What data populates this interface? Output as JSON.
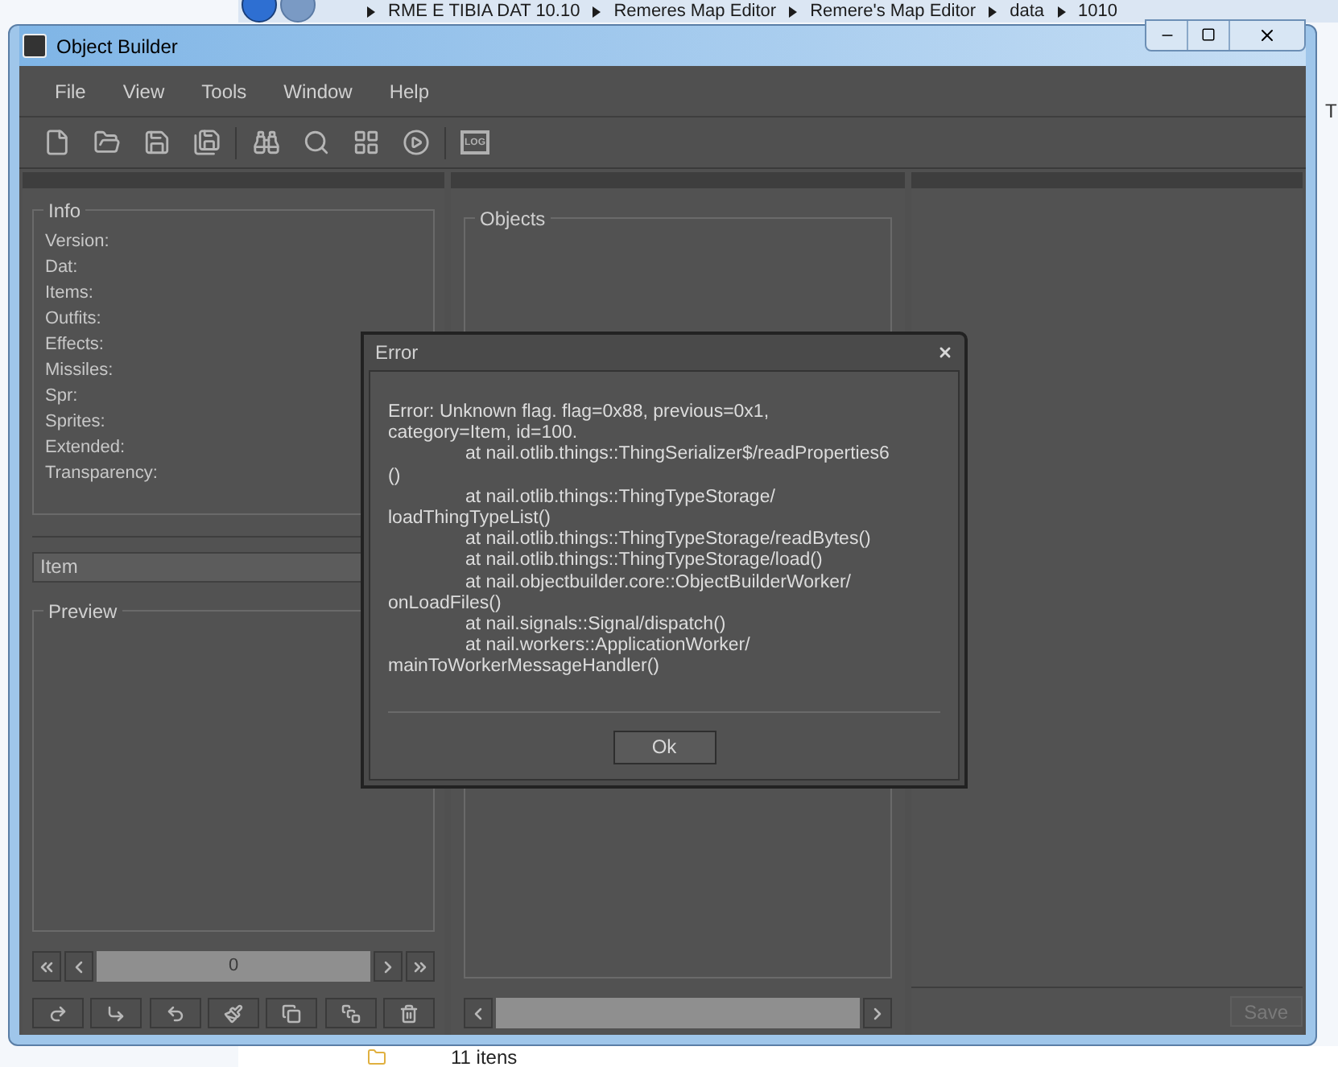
{
  "explorer": {
    "path": [
      "RME E TIBIA DAT 10.10",
      "Remeres Map Editor",
      "Remere's Map Editor",
      "data",
      "1010"
    ],
    "status": "11 itens",
    "edge_text": "T"
  },
  "window": {
    "title": "Object Builder"
  },
  "menu": [
    "File",
    "View",
    "Tools",
    "Window",
    "Help"
  ],
  "toolbar": {
    "log_label": "LOG"
  },
  "info": {
    "title": "Info",
    "fields": [
      "Version:",
      "Dat:",
      "Items:",
      "Outfits:",
      "Effects:",
      "Missiles:",
      "Spr:",
      "Sprites:",
      "Extended:",
      "Transparency:"
    ]
  },
  "category": {
    "value": "Item"
  },
  "preview": {
    "title": "Preview",
    "frame": "0"
  },
  "objects": {
    "title": "Objects"
  },
  "save_button": {
    "label": "Save",
    "disabled": true
  },
  "dialog": {
    "title": "Error",
    "button": "Ok",
    "lines": [
      {
        "text": "Error: Unknown flag. flag=0x88, previous=0x1,",
        "indented": false
      },
      {
        "text": "category=Item, id=100.",
        "indented": false
      },
      {
        "text": "at nail.otlib.things::ThingSerializer$/readProperties6",
        "indented": true
      },
      {
        "text": "()",
        "indented": false
      },
      {
        "text": "at nail.otlib.things::ThingTypeStorage/",
        "indented": true
      },
      {
        "text": "loadThingTypeList()",
        "indented": false
      },
      {
        "text": "at nail.otlib.things::ThingTypeStorage/readBytes()",
        "indented": true
      },
      {
        "text": "at nail.otlib.things::ThingTypeStorage/load()",
        "indented": true
      },
      {
        "text": "at nail.objectbuilder.core::ObjectBuilderWorker/",
        "indented": true
      },
      {
        "text": "onLoadFiles()",
        "indented": false
      },
      {
        "text": "at nail.signals::Signal/dispatch()",
        "indented": true
      },
      {
        "text": "at nail.workers::ApplicationWorker/",
        "indented": true
      },
      {
        "text": "mainToWorkerMessageHandler()",
        "indented": false
      }
    ]
  }
}
